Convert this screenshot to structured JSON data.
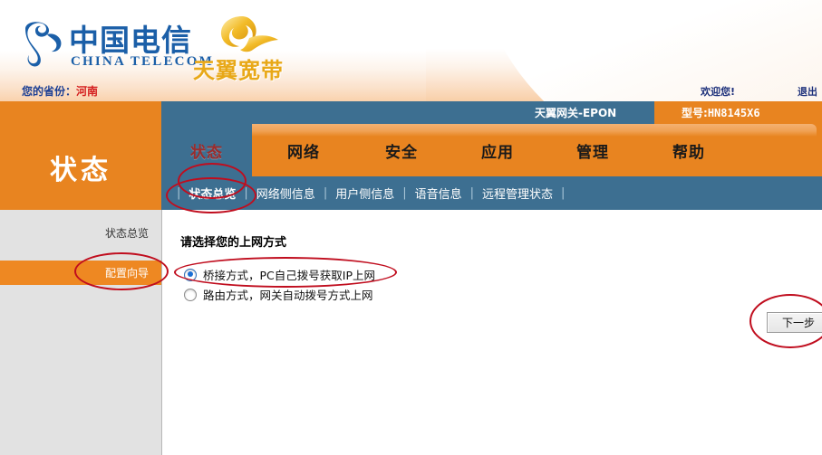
{
  "header": {
    "logo_cn": "中国电信",
    "logo_en": "CHINA TELECOM",
    "logo_tianyi": "天翼宽带",
    "province_label": "您的省份：",
    "province_value": "河南",
    "welcome": "欢迎您!",
    "logout": "退出"
  },
  "device": {
    "name": "天翼网关-EPON",
    "model_label": "型号:",
    "model_value": "HN8145X6"
  },
  "nav": {
    "tabs": [
      {
        "label": "状态",
        "active": true
      },
      {
        "label": "网络",
        "active": false
      },
      {
        "label": "安全",
        "active": false
      },
      {
        "label": "应用",
        "active": false
      },
      {
        "label": "管理",
        "active": false
      },
      {
        "label": "帮助",
        "active": false
      }
    ]
  },
  "panel": {
    "title": "状态"
  },
  "subnav": {
    "items": [
      {
        "label": "状态总览",
        "active": true
      },
      {
        "label": "网络侧信息",
        "active": false
      },
      {
        "label": "用户侧信息",
        "active": false
      },
      {
        "label": "语音信息",
        "active": false
      },
      {
        "label": "远程管理状态",
        "active": false
      }
    ],
    "separator": "|"
  },
  "sidebar": {
    "items": [
      {
        "label": "状态总览",
        "active": false
      },
      {
        "label": "配置向导",
        "active": true
      }
    ]
  },
  "main": {
    "heading": "请选择您的上网方式",
    "options": [
      {
        "label": "桥接方式，PC自己拨号获取IP上网",
        "selected": true
      },
      {
        "label": "路由方式，网关自动拨号方式上网",
        "selected": false
      }
    ],
    "next_button": "下一步"
  },
  "colors": {
    "orange": "#e88420",
    "steel_blue": "#3d6f91",
    "sidebar_gray": "#e2e2e2",
    "annotation_red": "#c00d1e",
    "telecom_blue": "#1b5fa8",
    "tianyi_gold": "#e8a818",
    "province_value_red": "#d41d1d"
  }
}
